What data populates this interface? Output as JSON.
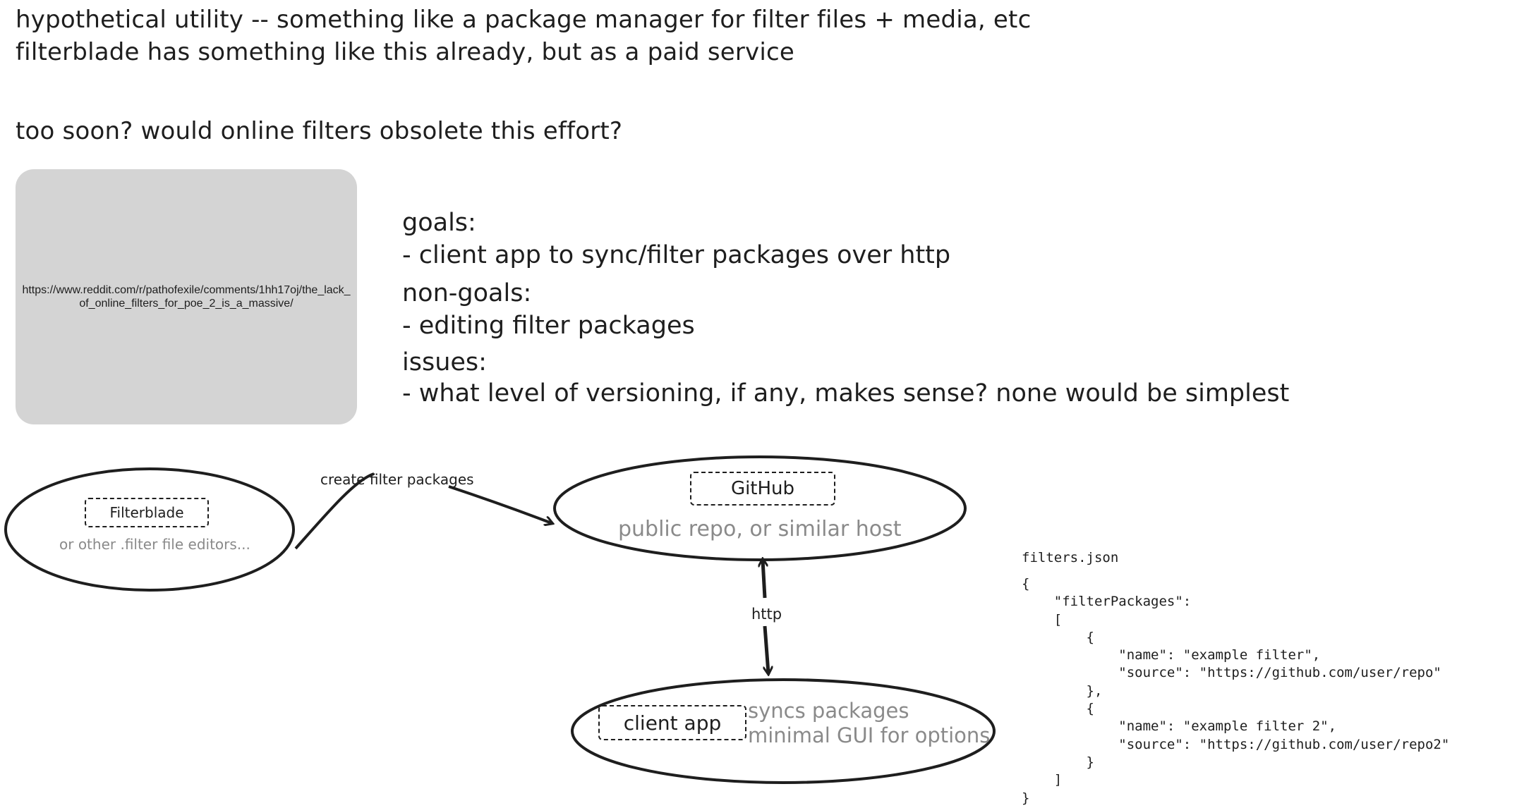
{
  "header": {
    "line1": "hypothetical utility -- something like a package manager for filter files + media, etc",
    "line2": "filterblade has something like this already, but as a paid service",
    "question": "too soon? would online filters obsolete this effort?"
  },
  "embed": {
    "url": "https://www.reddit.com/r/pathofexile/comments/1hh17oj/the_lack_of_online_filters_for_poe_2_is_a_massive/"
  },
  "notes": {
    "goals_heading": "goals:",
    "goals_item": "- client app to sync/filter packages over http",
    "nongoals_heading": "non-goals:",
    "nongoals_item": "- editing filter packages",
    "issues_heading": "issues:",
    "issues_item": "- what level of versioning, if any, makes sense? none would be simplest"
  },
  "diagram": {
    "filterblade": {
      "label": "Filterblade",
      "sub": "or other .filter file editors..."
    },
    "github": {
      "label": "GitHub",
      "sub": "public repo, or similar host"
    },
    "client": {
      "label": "client app",
      "sub1": "syncs packages",
      "sub2": "minimal GUI for options"
    },
    "arrow_create": "create filter packages",
    "arrow_http": "http"
  },
  "code": {
    "filename": "filters.json",
    "lines": [
      "{",
      "    \"filterPackages\":",
      "    [",
      "        {",
      "            \"name\": \"example filter\",",
      "            \"source\": \"https://github.com/user/repo\"",
      "        },",
      "        {",
      "            \"name\": \"example filter 2\",",
      "            \"source\": \"https://github.com/user/repo2\"",
      "        }",
      "    ]",
      "}"
    ]
  },
  "colors": {
    "stroke": "#1e1e1e",
    "muted_text": "#8a8a8a",
    "embed_bg": "#d4d4d4"
  }
}
